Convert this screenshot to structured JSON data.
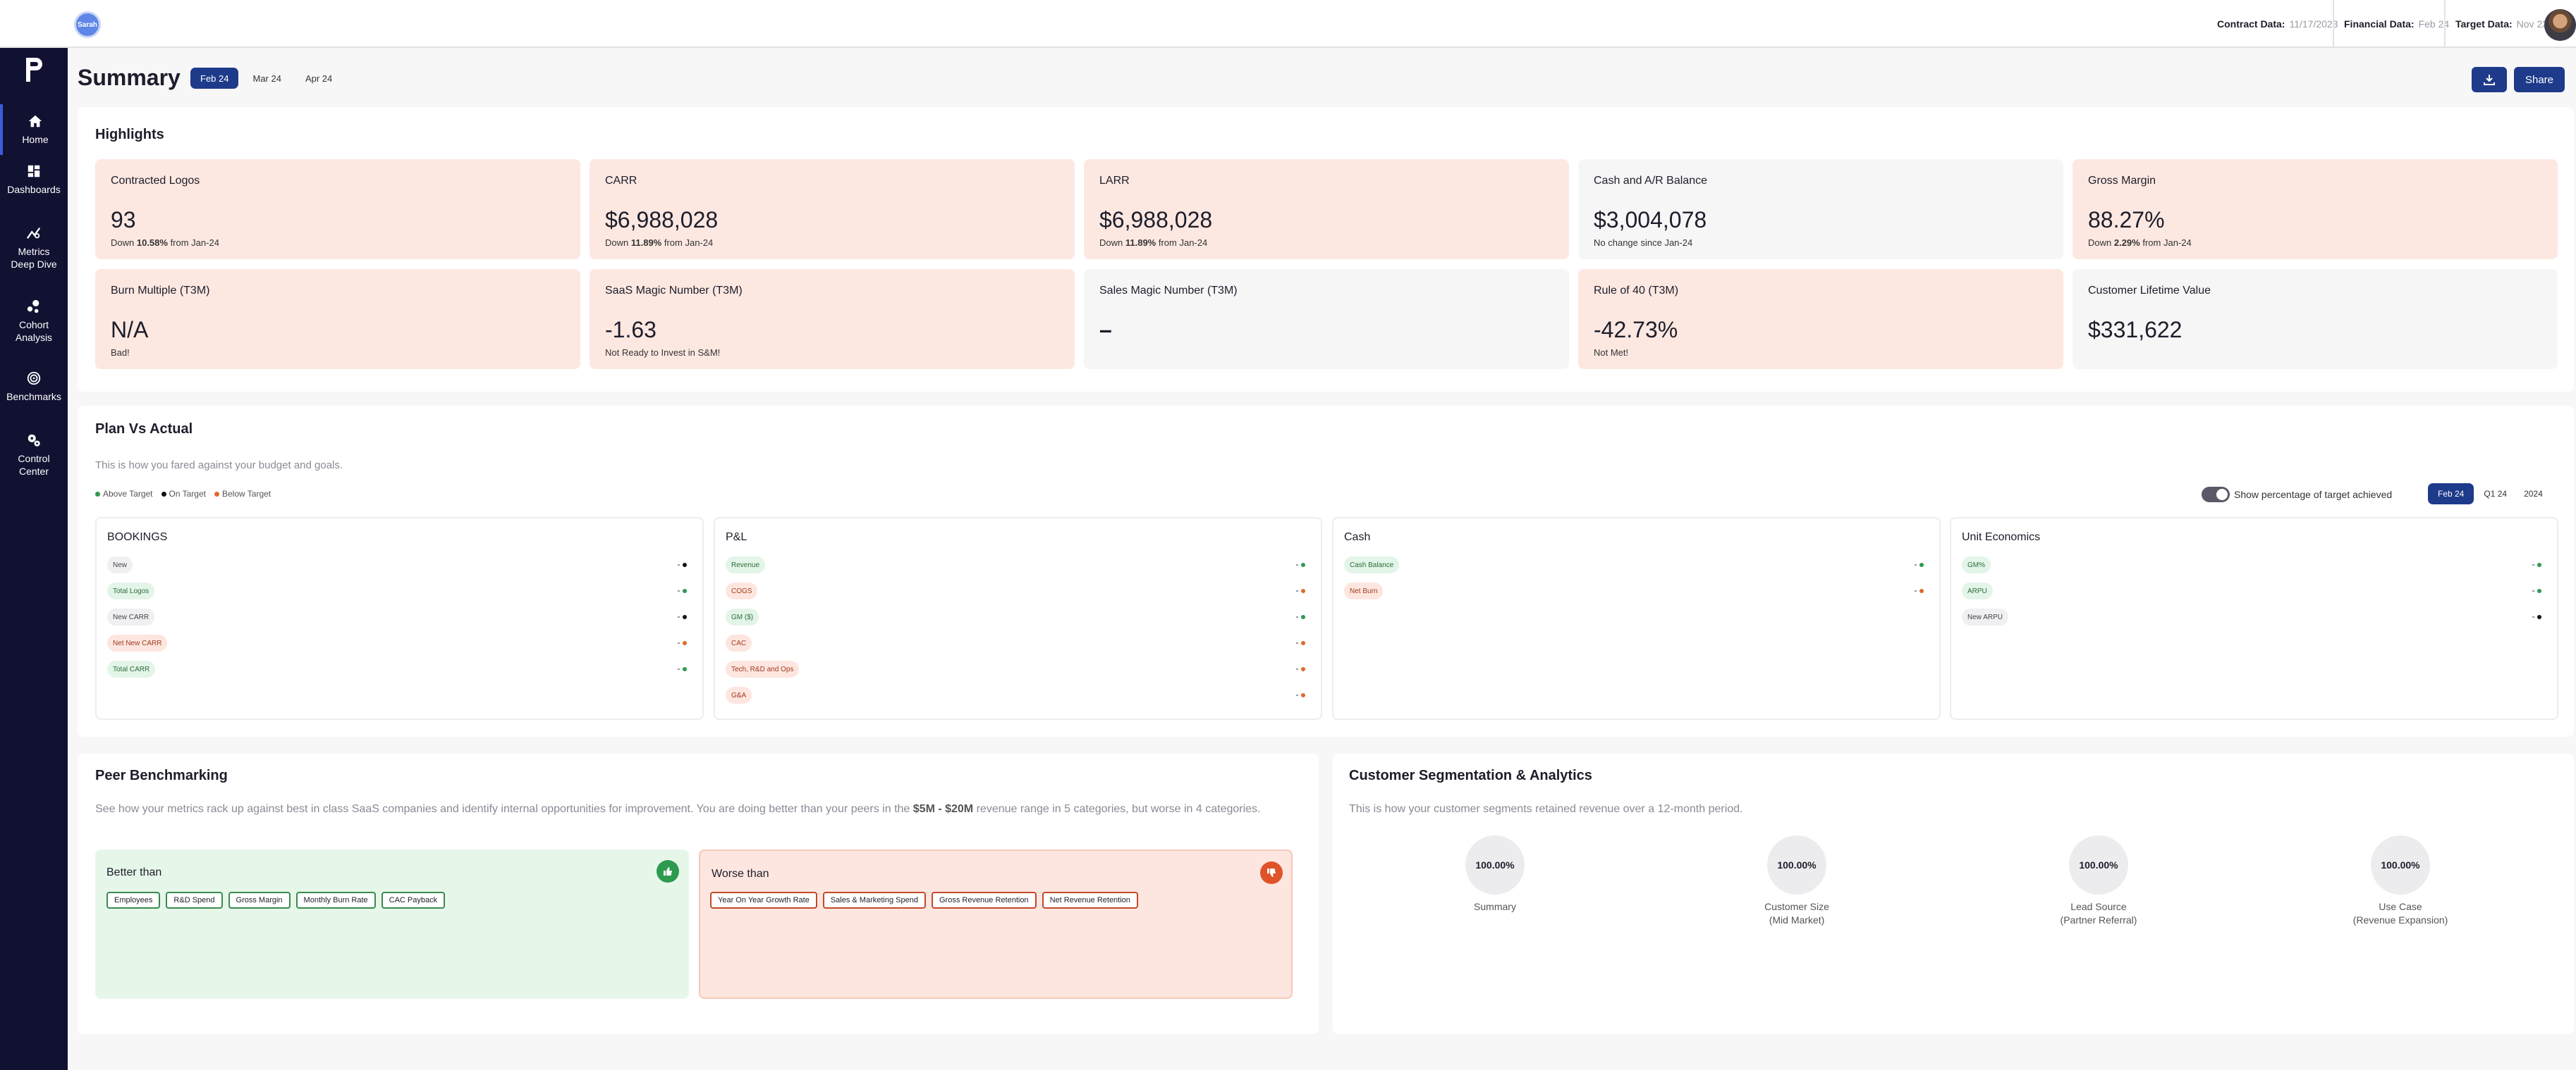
{
  "topbar": {
    "logo_text": "Sarah",
    "contract": {
      "label": "Contract Data:",
      "value": "11/17/2023"
    },
    "financial": {
      "label": "Financial Data:",
      "value": "Feb 24"
    },
    "target": {
      "label": "Target Data:",
      "value": "Nov 23"
    }
  },
  "sidebar": {
    "items": [
      {
        "label": "Home",
        "icon": "home-icon"
      },
      {
        "label": "Dashboards",
        "icon": "grid-icon"
      },
      {
        "label": "Metrics Deep Dive",
        "icon": "chart-icon"
      },
      {
        "label": "Cohort Analysis",
        "icon": "cohort-icon"
      },
      {
        "label": "Benchmarks",
        "icon": "target-icon"
      },
      {
        "label": "Control Center",
        "icon": "gears-icon"
      }
    ]
  },
  "header": {
    "title": "Summary",
    "periods": [
      "Feb 24",
      "Mar 24",
      "Apr 24"
    ],
    "selected_period": "Feb 24",
    "share_label": "Share"
  },
  "highlights": {
    "title": "Highlights",
    "cards": [
      {
        "title": "Contracted Logos",
        "value": "93",
        "sub_pre": "Down ",
        "sub_bold": "10.58%",
        "sub_post": " from Jan-24",
        "tone": "red"
      },
      {
        "title": "CARR",
        "value": "$6,988,028",
        "sub_pre": "Down ",
        "sub_bold": "11.89%",
        "sub_post": " from Jan-24",
        "tone": "red"
      },
      {
        "title": "LARR",
        "value": "$6,988,028",
        "sub_pre": "Down ",
        "sub_bold": "11.89%",
        "sub_post": " from Jan-24",
        "tone": "red"
      },
      {
        "title": "Cash and A/R Balance",
        "value": "$3,004,078",
        "sub_pre": "No change since Jan-24",
        "sub_bold": "",
        "sub_post": "",
        "tone": "neutral"
      },
      {
        "title": "Gross Margin",
        "value": "88.27%",
        "sub_pre": "Down ",
        "sub_bold": "2.29%",
        "sub_post": " from Jan-24",
        "tone": "red"
      },
      {
        "title": "Burn Multiple (T3M)",
        "value": "N/A",
        "sub_pre": "Bad!",
        "sub_bold": "",
        "sub_post": "",
        "tone": "red"
      },
      {
        "title": "SaaS Magic Number (T3M)",
        "value": "-1.63",
        "sub_pre": "Not Ready to Invest in S&M!",
        "sub_bold": "",
        "sub_post": "",
        "tone": "red"
      },
      {
        "title": "Sales Magic Number (T3M)",
        "value": "–",
        "sub_pre": "",
        "sub_bold": "",
        "sub_post": "",
        "tone": "neutral"
      },
      {
        "title": "Rule of 40 (T3M)",
        "value": "-42.73%",
        "sub_pre": "Not Met!",
        "sub_bold": "",
        "sub_post": "",
        "tone": "red"
      },
      {
        "title": "Customer Lifetime Value",
        "value": "$331,622",
        "sub_pre": "",
        "sub_bold": "",
        "sub_post": "",
        "tone": "neutral"
      }
    ]
  },
  "pva": {
    "title": "Plan Vs Actual",
    "subtitle": "This is how you fared against your budget and goals.",
    "legend": [
      {
        "label": "Above Target",
        "color": "#2e9a4f"
      },
      {
        "label": "On Target",
        "color": "#111111"
      },
      {
        "label": "Below Target",
        "color": "#e06a2b"
      }
    ],
    "toggle_label": "Show percentage of target achieved",
    "periods": [
      "Feb 24",
      "Q1 24",
      "2024"
    ],
    "selected_period": "Feb 24",
    "columns": [
      {
        "title": "BOOKINGS",
        "rows": [
          {
            "label": "New",
            "tone": "grey",
            "dot": "#111111"
          },
          {
            "label": "Total Logos",
            "tone": "green",
            "dot": "#2e9a4f"
          },
          {
            "label": "New CARR",
            "tone": "grey",
            "dot": "#111111"
          },
          {
            "label": "Net New CARR",
            "tone": "red",
            "dot": "#e06a2b"
          },
          {
            "label": "Total CARR",
            "tone": "green",
            "dot": "#2e9a4f"
          }
        ]
      },
      {
        "title": "P&L",
        "rows": [
          {
            "label": "Revenue",
            "tone": "green",
            "dot": "#2e9a4f"
          },
          {
            "label": "COGS",
            "tone": "red",
            "dot": "#e06a2b"
          },
          {
            "label": "GM ($)",
            "tone": "green",
            "dot": "#2e9a4f"
          },
          {
            "label": "CAC",
            "tone": "red",
            "dot": "#e06a2b"
          },
          {
            "label": "Tech, R&D and Ops",
            "tone": "red",
            "dot": "#e06a2b"
          },
          {
            "label": "G&A",
            "tone": "red",
            "dot": "#e06a2b"
          }
        ]
      },
      {
        "title": "Cash",
        "rows": [
          {
            "label": "Cash Balance",
            "tone": "green",
            "dot": "#2e9a4f"
          },
          {
            "label": "Net Burn",
            "tone": "red",
            "dot": "#e06a2b"
          }
        ]
      },
      {
        "title": "Unit Economics",
        "rows": [
          {
            "label": "GM%",
            "tone": "green",
            "dot": "#2e9a4f"
          },
          {
            "label": "ARPU",
            "tone": "green",
            "dot": "#2e9a4f"
          },
          {
            "label": "New ARPU",
            "tone": "grey",
            "dot": "#111111"
          }
        ]
      }
    ]
  },
  "peer": {
    "title": "Peer Benchmarking",
    "subtitle_pre": "See how your metrics rack up against best in class SaaS companies and identify internal opportunities for improvement. You are doing better than your peers in the ",
    "subtitle_bold": "$5M - $20M",
    "subtitle_post": " revenue range in 5 categories, but worse in 4 categories.",
    "better": {
      "title": "Better than",
      "tags": [
        "Employees",
        "R&D Spend",
        "Gross Margin",
        "Monthly Burn Rate",
        "CAC Payback"
      ]
    },
    "worse": {
      "title": "Worse than",
      "tags": [
        "Year On Year Growth Rate",
        "Sales & Marketing Spend",
        "Gross Revenue Retention",
        "Net Revenue Retention"
      ]
    }
  },
  "segmentation": {
    "title": "Customer Segmentation & Analytics",
    "subtitle": "This is how your customer segments retained revenue over a 12-month period.",
    "items": [
      {
        "value": "100.00%",
        "label": "Summary",
        "sub": ""
      },
      {
        "value": "100.00%",
        "label": "Customer Size",
        "sub": "(Mid Market)"
      },
      {
        "value": "100.00%",
        "label": "Lead Source",
        "sub": "(Partner Referral)"
      },
      {
        "value": "100.00%",
        "label": "Use Case",
        "sub": "(Revenue Expansion)"
      }
    ]
  }
}
